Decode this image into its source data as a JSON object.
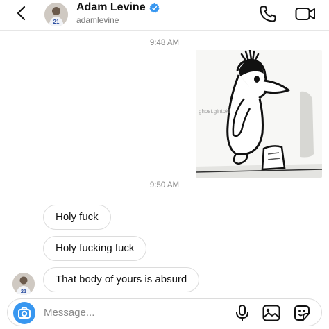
{
  "header": {
    "name": "Adam Levine",
    "handle": "adamlevine",
    "verified": true,
    "jersey_number": "21"
  },
  "messages": [
    {
      "type": "timestamp",
      "text": "9:48 AM"
    },
    {
      "type": "image",
      "watermark": "ghost.gintoki"
    },
    {
      "type": "timestamp",
      "text": "9:50 AM"
    },
    {
      "type": "text",
      "text": "Holy fuck"
    },
    {
      "type": "text",
      "text": "Holy fucking fuck"
    },
    {
      "type": "text",
      "text": "That body of yours is absurd"
    }
  ],
  "composer": {
    "placeholder": "Message..."
  },
  "colors": {
    "accent": "#3897f0",
    "verified": "#3897f0",
    "icon": "#111111",
    "muted_text": "#8a8a8a"
  },
  "icons": [
    "chevron-left-icon",
    "verified-icon",
    "phone-icon",
    "video-camera-icon",
    "camera-icon",
    "microphone-icon",
    "gallery-icon",
    "sticker-icon"
  ]
}
